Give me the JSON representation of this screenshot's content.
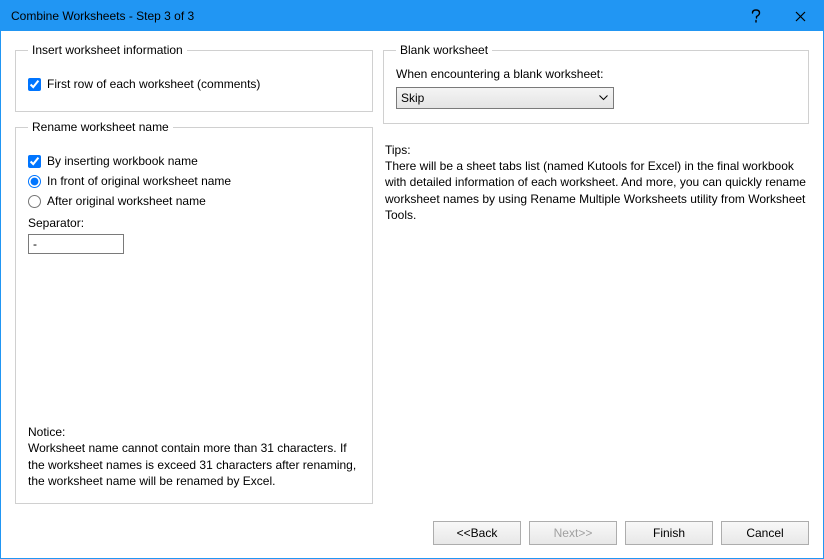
{
  "titlebar": {
    "title": "Combine Worksheets - Step 3 of 3"
  },
  "insert_info": {
    "legend": "Insert worksheet information",
    "first_row_label": "First row of each worksheet (comments)",
    "first_row_checked": true
  },
  "rename": {
    "legend": "Rename worksheet name",
    "by_inserting_label": "By inserting workbook name",
    "by_inserting_checked": true,
    "front_label": "In front of original worksheet name",
    "after_label": "After original worksheet name",
    "position": "front",
    "separator_label": "Separator:",
    "separator_value": "-",
    "notice_label": "Notice:",
    "notice_text": "Worksheet name cannot contain more than 31 characters. If the worksheet names is exceed 31 characters after renaming, the worksheet name will be renamed by Excel."
  },
  "blank": {
    "legend": "Blank worksheet",
    "when_label": "When encountering a blank worksheet:",
    "selected": "Skip"
  },
  "tips": {
    "label": "Tips:",
    "text": "There will be a sheet tabs list (named Kutools for Excel) in the final workbook with detailed information of each worksheet. And more, you can quickly rename worksheet names by using Rename Multiple Worksheets utility from Worksheet Tools."
  },
  "buttons": {
    "back": "<<Back",
    "next": "Next>>",
    "finish": "Finish",
    "cancel": "Cancel"
  }
}
